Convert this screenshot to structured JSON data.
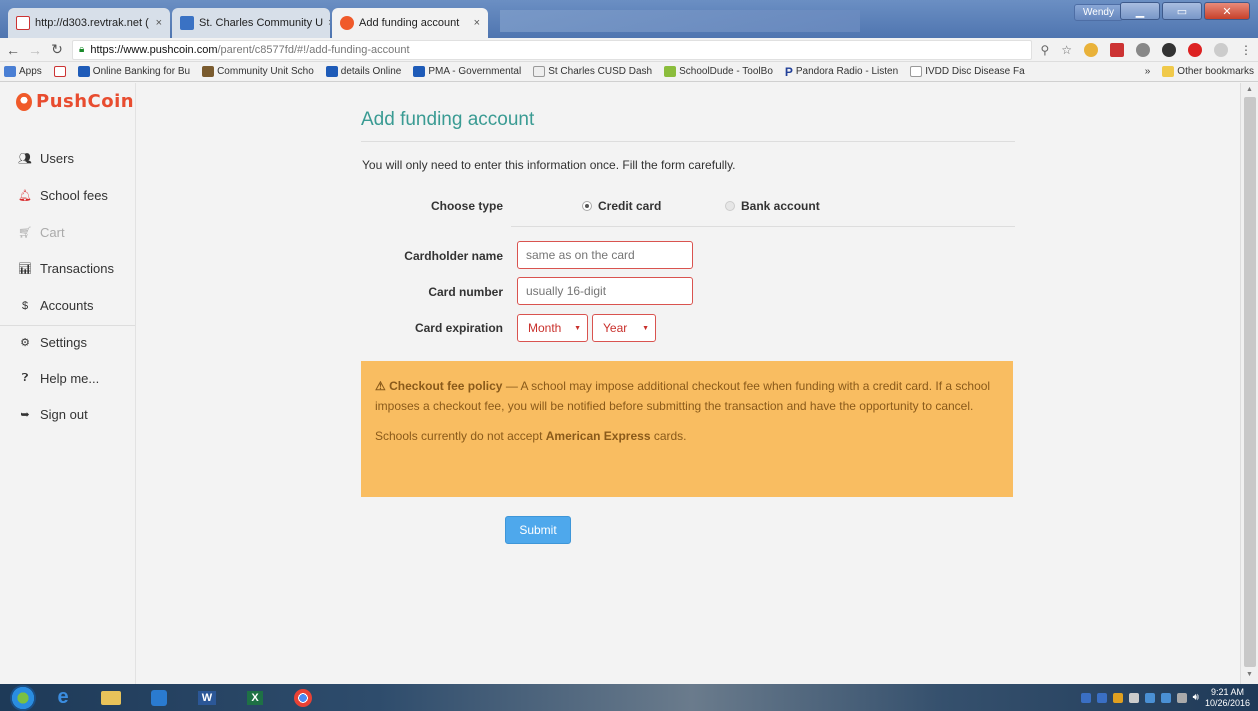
{
  "browser": {
    "tabs": [
      {
        "label": "http://d303.revtrak.net ("
      },
      {
        "label": "St. Charles Community U"
      },
      {
        "label": "Add funding account"
      }
    ],
    "user": "Wendy",
    "url_host": "https://www.pushcoin.com",
    "url_path": "/parent/c8577fd/#!/add-funding-account"
  },
  "bookmarks": {
    "items": [
      {
        "label": "Apps"
      },
      {
        "label": "Online Banking for Bu"
      },
      {
        "label": "Community Unit Scho"
      },
      {
        "label": "details Online"
      },
      {
        "label": "PMA - Governmental"
      },
      {
        "label": "St Charles CUSD Dash"
      },
      {
        "label": "SchoolDude - ToolBo"
      },
      {
        "label": "Pandora Radio - Listen"
      },
      {
        "label": "IVDD Disc Disease Fa"
      }
    ],
    "more": "»",
    "other": "Other bookmarks"
  },
  "sidebar": {
    "logo": "PushCoin",
    "items": [
      {
        "label": "Users",
        "icon": "users-icon"
      },
      {
        "label": "School fees",
        "icon": "bell-icon"
      },
      {
        "label": "Cart",
        "icon": "cart-icon"
      },
      {
        "label": "Transactions",
        "icon": "bar-chart-icon"
      },
      {
        "label": "Accounts",
        "icon": "dollar-icon"
      },
      {
        "label": "Settings",
        "icon": "gears-icon"
      },
      {
        "label": "Help me...",
        "icon": "question-circle-icon"
      },
      {
        "label": "Sign out",
        "icon": "sign-out-icon"
      }
    ]
  },
  "form": {
    "title": "Add funding account",
    "intro": "You will only need to enter this information once. Fill the form carefully.",
    "choose_type_label": "Choose type",
    "type_options": [
      {
        "label": "Credit card",
        "selected": true
      },
      {
        "label": "Bank account",
        "selected": false
      }
    ],
    "cardholder_label": "Cardholder name",
    "cardholder_placeholder": "same as on the card",
    "card_number_label": "Card number",
    "card_number_placeholder": "usually 16-digit",
    "expiration_label": "Card expiration",
    "month_label": "Month",
    "year_label": "Year",
    "submit_label": "Submit"
  },
  "alert": {
    "heading": "Checkout fee policy",
    "body": " — A school may impose additional checkout fee when funding with a credit card. If a school imposes a checkout fee, you will be notified before submitting the transaction and have the opportunity to cancel.",
    "amex_pre": "Schools currently do not accept ",
    "amex_bold": "American Express",
    "amex_post": " cards."
  },
  "taskbar": {
    "time": "9:21 AM",
    "date": "10/26/2016"
  },
  "colors": {
    "accent_title": "#3a9b93",
    "alert_bg": "#f9bd61",
    "submit_bg": "#4ea8ec",
    "logo": "#e84c2f",
    "invalid_border": "#d9534f"
  }
}
